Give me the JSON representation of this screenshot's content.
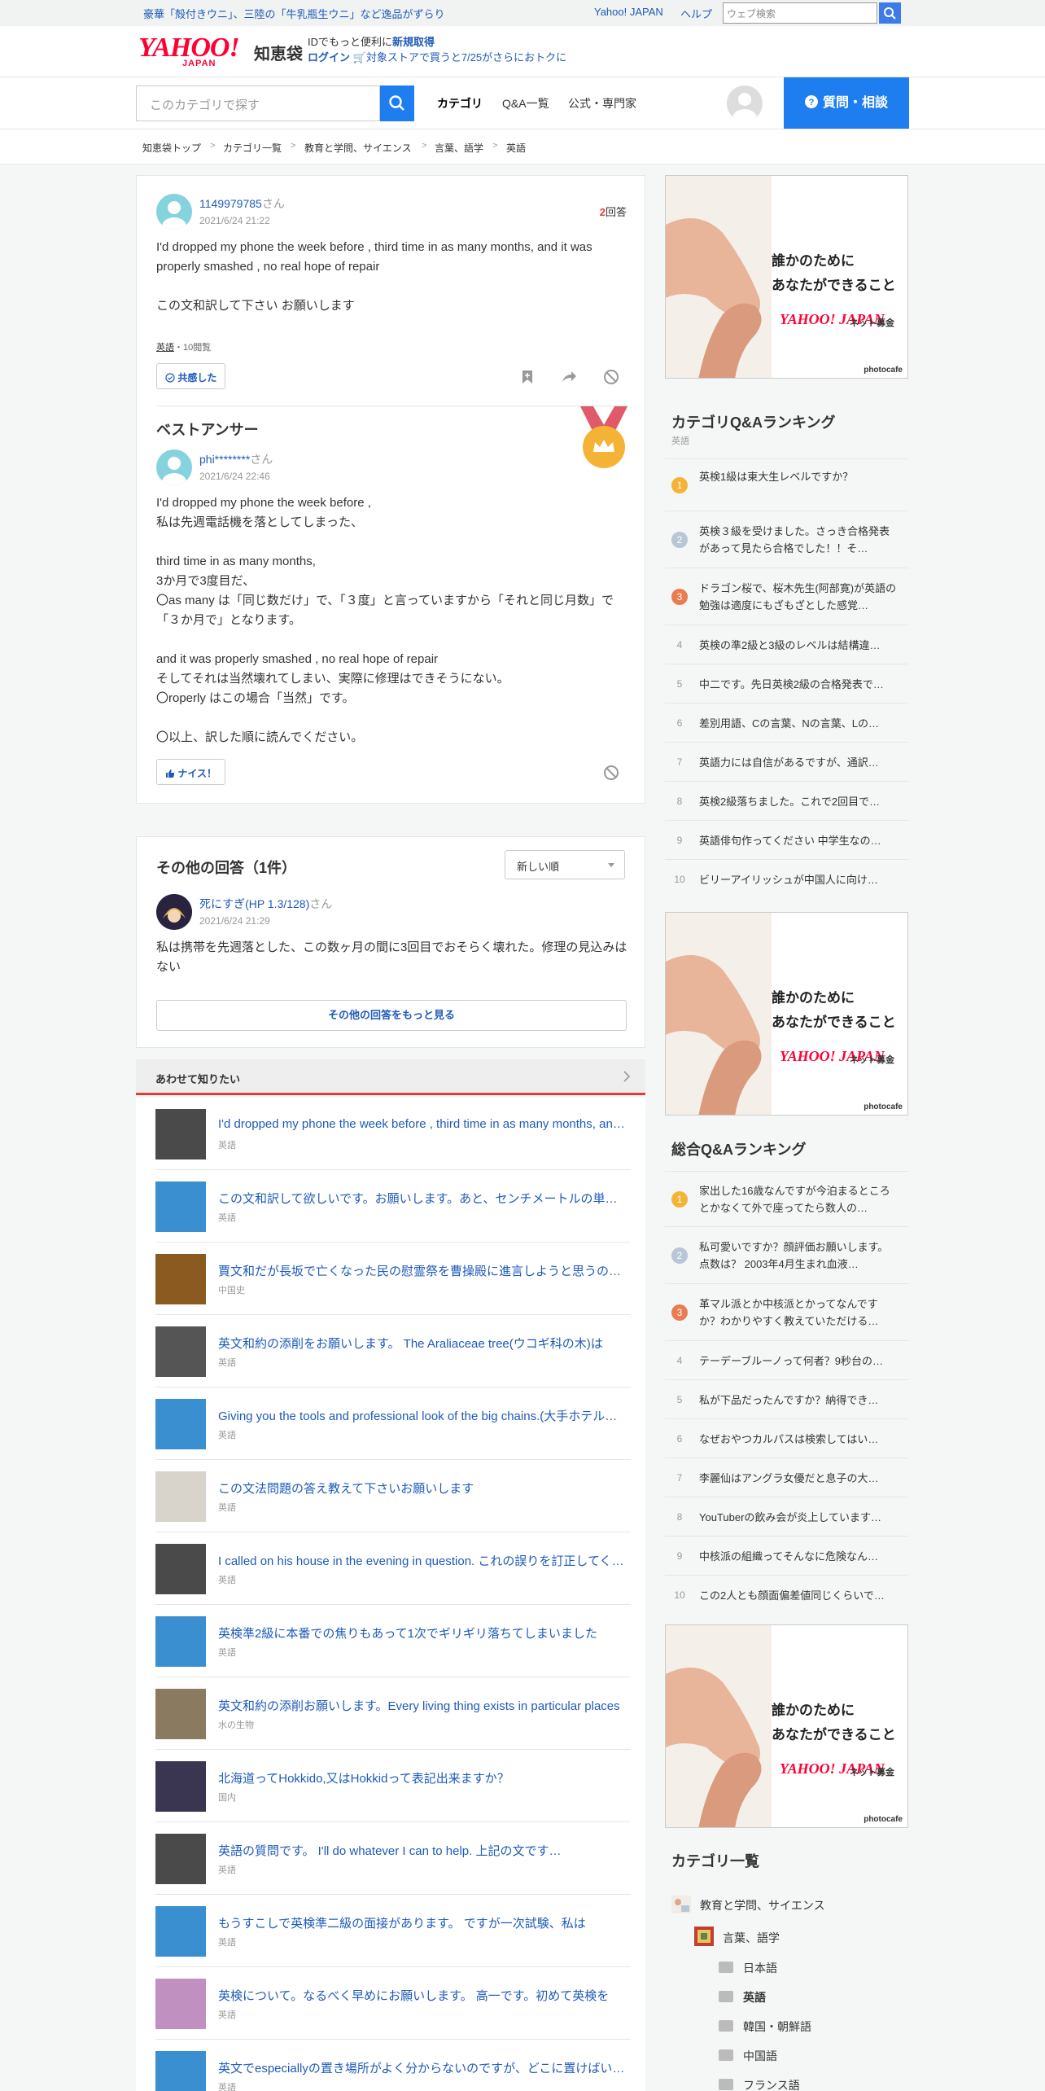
{
  "topbar": {
    "promo": "豪華「殻付きウニ」、三陸の「牛乳瓶生ウニ」など逸品がずらり",
    "yahoo_japan": "Yahoo! JAPAN",
    "help": "ヘルプ",
    "search_placeholder": "ウェブ検索"
  },
  "header": {
    "logo_text": "YAHOO!",
    "logo_sub": "JAPAN",
    "logo_service": "知恵袋",
    "id_line_pre": "IDでもっと便利に",
    "id_line_link": "新規取得",
    "login": "ログイン",
    "store_line": "対象ストアで買うと7/25がさらにおトクに"
  },
  "nav": {
    "cat_search_placeholder": "このカテゴリで探す",
    "tabs": [
      {
        "label": "カテゴリ"
      },
      {
        "label": "Q&A一覧"
      },
      {
        "label": "公式・専門家"
      }
    ],
    "ask_button": "質問・相談"
  },
  "breadcrumb": [
    "知恵袋トップ",
    "カテゴリ一覧",
    "教育と学問、サイエンス",
    "言葉、語学",
    "英語"
  ],
  "question": {
    "user": "1149979785",
    "san": "さん",
    "date": "2021/6/24 21:22",
    "answer_count": "2",
    "answer_label": "回答",
    "text": "I'd dropped my phone the week before , third time in as many months, and it was properly smashed , no real hope of repair\n\nこの文和訳して下さい お願いします",
    "category": "英語",
    "views": "・10閲覧",
    "empathy_button": "共感した"
  },
  "best_answer": {
    "heading": "ベストアンサー",
    "user": "phi********",
    "san": "さん",
    "date": "2021/6/24 22:46",
    "text": "I'd dropped my phone the week before ,\n私は先週電話機を落としてしまった、\n\nthird time in as many months,\n3か月で3度目だ、\n〇as many は「同じ数だけ」で、「３度」と言っていますから「それと同じ月数」で「３か月で」となります。\n\nand it was properly smashed , no real hope of repair\nそしてそれは当然壊れてしまい、実際に修理はできそうにない。\n〇roperly はこの場合「当然」です。\n\n〇以上、訳した順に読んでください。",
    "nice_button": "ナイス！"
  },
  "other_answers": {
    "heading": "その他の回答（1件）",
    "sort": "新しい順",
    "user": "死にすぎ(HP 1.3/128)",
    "san": "さん",
    "date": "2021/6/24 21:29",
    "text": "私は携帯を先週落とした、この数ヶ月の間に3回目でおそらく壊れた。修理の見込みはない",
    "more_button": "その他の回答をもっと見る"
  },
  "related": {
    "heading": "あわせて知りたい",
    "items": [
      {
        "title": "I'd dropped my phone the week before , third time in as many months, and it was properly smashed",
        "cat": "英語"
      },
      {
        "title": "この文和訳して欲しいです。お願いします。あと、センチメートルの単位もお願いします",
        "cat": "英語"
      },
      {
        "title": "賈文和だが長坂で亡くなった民の慰霊祭を曹操殿に進言しようと思うのですが",
        "cat": "中国史"
      },
      {
        "title": "英文和約の添削をお願いします。 The Araliaceae tree(ウコギ科の木)は",
        "cat": "英語"
      },
      {
        "title": "Giving you the tools and professional look of the big chains.(大手ホテルチェーン",
        "cat": "英語"
      },
      {
        "title": "この文法問題の答え教えて下さいお願いします",
        "cat": "英語"
      },
      {
        "title": "I called on his house in the evening in question. これの誤りを訂正してください",
        "cat": "英語"
      },
      {
        "title": "英検準2級に本番での焦りもあって1次でギリギリ落ちてしまいました",
        "cat": "英語"
      },
      {
        "title": "英文和約の添削お願いします。Every living thing exists in particular places",
        "cat": "水の生物"
      },
      {
        "title": "北海道ってHokkido,又はHokkidって表記出来ますか？",
        "cat": "国内"
      },
      {
        "title": "英語の質問です。 I'll do whatever I can to help. 上記の文です…",
        "cat": "英語"
      },
      {
        "title": "もうすこしで英検準二級の面接があります。 ですが一次試験、私は",
        "cat": "英語"
      },
      {
        "title": "英検について。なるべく早めにお願いします。 高一です。初めて英検を",
        "cat": "英語"
      },
      {
        "title": "英文でespeciallyの置き場所がよく分からないのですが、どこに置けばいいですか",
        "cat": "英語"
      }
    ]
  },
  "ad": {
    "line1": "誰かのために",
    "line2": "あなたができること",
    "logo": "YAHOO! JAPAN",
    "sub": "ネット募金",
    "credit": "photocafe"
  },
  "category_ranking": {
    "title": "カテゴリQ&Aランキング",
    "subtitle": "英語",
    "items": [
      {
        "n": "1",
        "text": "英検1級は東大生レベルですか？"
      },
      {
        "n": "2",
        "text": "英検３級を受けました。さっき合格発表があって見たら合格でした！！そ…"
      },
      {
        "n": "3",
        "text": "ドラゴン桜で、桜木先生(阿部寛)が英語の勉強は適度にもざもざとした感覚…"
      },
      {
        "n": "4",
        "text": "英検の準2級と3級のレベルは結構違…"
      },
      {
        "n": "5",
        "text": "中二です。先日英検2級の合格発表で…"
      },
      {
        "n": "6",
        "text": "差別用語、Cの言葉、Nの言葉、Lの…"
      },
      {
        "n": "7",
        "text": "英語力には自信があるですが、通訳…"
      },
      {
        "n": "8",
        "text": "英検2級落ちました。これで2回目で…"
      },
      {
        "n": "9",
        "text": "英語俳句作ってください 中学生なの…"
      },
      {
        "n": "10",
        "text": "ビリーアイリッシュが中国人に向け…"
      }
    ]
  },
  "overall_ranking": {
    "title": "総合Q&Aランキング",
    "items": [
      {
        "n": "1",
        "text": "家出した16歳なんですが今泊まるところとかなくて外で座ってたら数人の…"
      },
      {
        "n": "2",
        "text": "私可愛いですか？顔評価お願いします。点数は？ 2003年4月生まれ血液…"
      },
      {
        "n": "3",
        "text": "革マル派とか中核派とかってなんですか？わかりやすく教えていただける…"
      },
      {
        "n": "4",
        "text": "テーデーブルーノって何者？9秒台の…"
      },
      {
        "n": "5",
        "text": "私が下品だったんですか？納得でき…"
      },
      {
        "n": "6",
        "text": "なぜおやつカルパスは検索してはい…"
      },
      {
        "n": "7",
        "text": "李麗仙はアングラ女優だと息子の大…"
      },
      {
        "n": "8",
        "text": "YouTuberの飲み会が炎上しています…"
      },
      {
        "n": "9",
        "text": "中核派の組織ってそんなに危険なん…"
      },
      {
        "n": "10",
        "text": "この2人とも顔面偏差値同じくらいで…"
      }
    ]
  },
  "category_list": {
    "title": "カテゴリ一覧",
    "items": [
      {
        "label": "教育と学問、サイエンス"
      },
      {
        "label": "言葉、語学"
      },
      {
        "label": "日本語"
      },
      {
        "label": "英語"
      },
      {
        "label": "韓国・朝鮮語"
      },
      {
        "label": "中国語"
      },
      {
        "label": "フランス語"
      }
    ]
  },
  "colors": {
    "accent": "#1e7ef0",
    "link": "#1e5bb8",
    "brand": "#ff0033",
    "medal": "#f5b335"
  }
}
